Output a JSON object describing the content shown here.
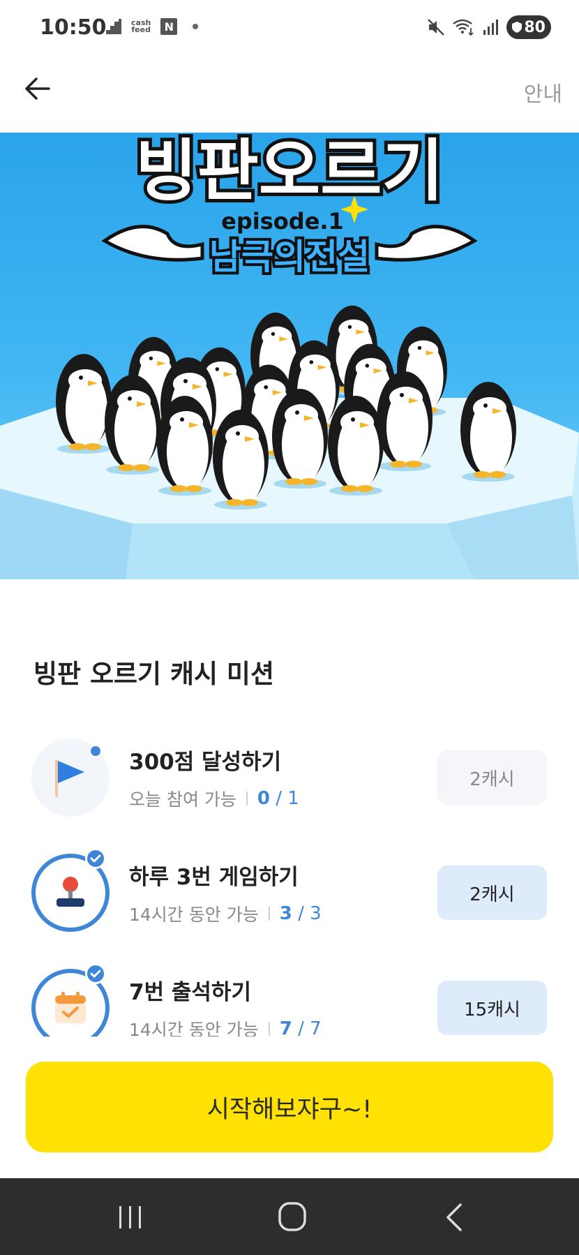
{
  "status_bar": {
    "time": "10:50",
    "cash_line1": "cash",
    "cash_line2": "feed",
    "n_label": "N",
    "battery": "80",
    "icons": [
      "staircase-icon",
      "cashfeed-icon",
      "naver-icon",
      "dot-icon",
      "mute-icon",
      "wifi-icon",
      "signal-icon",
      "battery-icon"
    ]
  },
  "header": {
    "back_icon": "arrow-left-icon",
    "guide_label": "안내"
  },
  "banner": {
    "title": "빙판오르기",
    "episode": "episode.1",
    "subtitle": "남극의전설"
  },
  "section": {
    "title": "빙판 오르기 캐시 미션"
  },
  "missions": [
    {
      "title": "300점 달성하기",
      "subtitle": "오늘 참여 가능",
      "current": "0",
      "separator": "/",
      "total": "1",
      "reward": "2캐시",
      "icon": "flag-icon",
      "status": "pending"
    },
    {
      "title": "하루 3번 게임하기",
      "subtitle": "14시간 동안 가능",
      "current": "3",
      "separator": "/",
      "total": "3",
      "reward": "2캐시",
      "icon": "joystick-icon",
      "status": "done"
    },
    {
      "title": "7번 출석하기",
      "subtitle": "14시간 동안 가능",
      "current": "7",
      "separator": "/",
      "total": "7",
      "reward": "15캐시",
      "icon": "calendar-check-icon",
      "status": "done"
    }
  ],
  "start_button": {
    "label": "시작해보쟈구~!"
  },
  "nav_bar": {
    "icons": [
      "recent-apps-icon",
      "home-icon",
      "back-nav-icon"
    ]
  },
  "colors": {
    "accent_blue": "#3f86d8",
    "start_yellow": "#ffe203",
    "banner_blue": "#29a3ea"
  }
}
